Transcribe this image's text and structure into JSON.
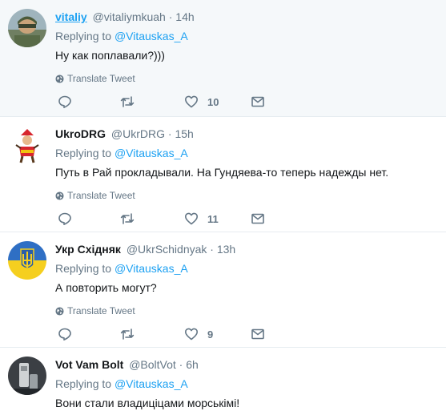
{
  "ui": {
    "replying_prefix": "Replying to",
    "translate_label": "Translate Tweet",
    "dot": "·"
  },
  "tweets": [
    {
      "name": "vitaliy",
      "handle": "@vitaliymkuah",
      "time": "14h",
      "reply_to": "@Vitauskas_A",
      "text": "Ну как поплавали?)))",
      "likes": "10"
    },
    {
      "name": "UkroDRG",
      "handle": "@UkrDRG",
      "time": "15h",
      "reply_to": "@Vitauskas_A",
      "text": "Путь в Рай прокладывали. На Гундяева-то теперь надежды нет.",
      "likes": "11"
    },
    {
      "name": "Укр Східняк",
      "handle": "@UkrSchidnyak",
      "time": "13h",
      "reply_to": "@Vitauskas_A",
      "text": "А повторить могут?",
      "likes": "9"
    },
    {
      "name": "Vot Vam Bolt",
      "handle": "@BoltVot",
      "time": "6h",
      "reply_to": "@Vitauskas_A",
      "text": "Вони стали владицiцами морськiмi!"
    }
  ]
}
